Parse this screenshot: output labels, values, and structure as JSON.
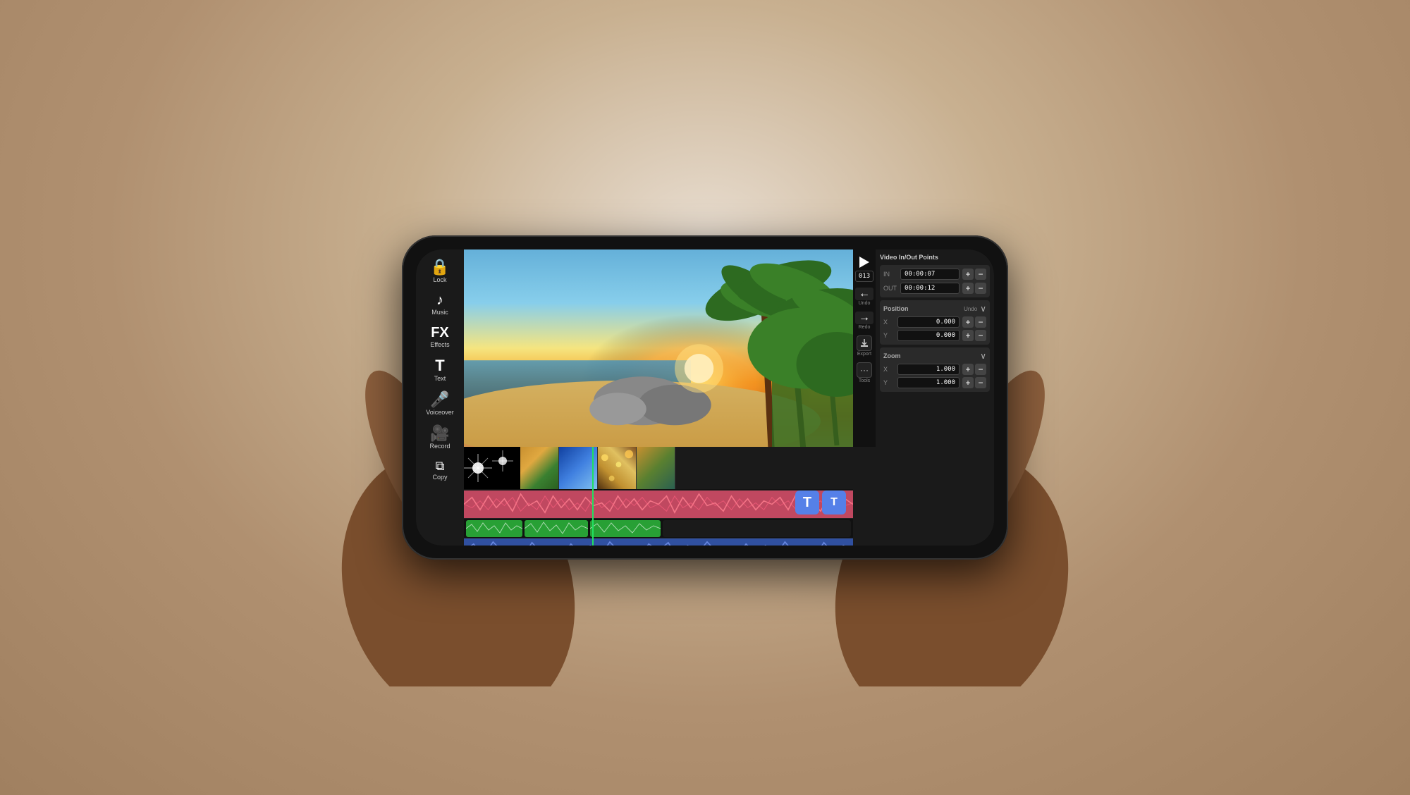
{
  "background": {
    "color": "#c8b090"
  },
  "sidebar": {
    "items": [
      {
        "id": "lock",
        "icon": "🔒",
        "label": "Lock"
      },
      {
        "id": "music",
        "icon": "♪",
        "label": "Music"
      },
      {
        "id": "fx",
        "icon": "FX",
        "label": "Effects",
        "type": "fx"
      },
      {
        "id": "text",
        "icon": "T",
        "label": "Text",
        "type": "text"
      },
      {
        "id": "voiceover",
        "icon": "🎤",
        "label": "Voiceover"
      },
      {
        "id": "record",
        "icon": "🎥",
        "label": "Record"
      },
      {
        "id": "copy",
        "icon": "⧉",
        "label": "Copy"
      }
    ]
  },
  "transport": {
    "play_icon": "▶",
    "counter": "013",
    "undo_label": "Undo",
    "redo_label": "Redo",
    "export_label": "Export",
    "tools_label": "Tools"
  },
  "properties": {
    "title": "Video In/Out Points",
    "in_out": {
      "in_label": "IN",
      "out_label": "OUT",
      "in_time": "00:00:07",
      "out_time": "00:00:12"
    },
    "position": {
      "title": "Position",
      "undo_label": "Undo",
      "x_label": "X",
      "y_label": "Y",
      "x_value": "0.000",
      "y_value": "0.000"
    },
    "zoom": {
      "title": "Zoom",
      "x_label": "X",
      "y_label": "Y",
      "x_value": "1.000",
      "y_value": "1.000"
    }
  },
  "timeline": {
    "tt_buttons": [
      "T",
      "T"
    ]
  }
}
